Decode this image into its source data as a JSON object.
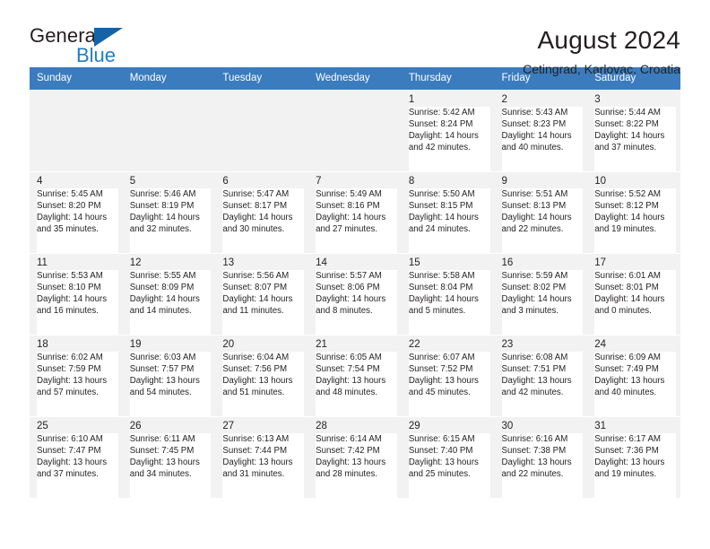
{
  "brand": {
    "name_primary": "General",
    "name_secondary": "Blue",
    "logo_icon": "triangle-logo-icon"
  },
  "header": {
    "title": "August 2024",
    "subtitle": "Cetingrad, Karlovac, Croatia"
  },
  "colors": {
    "header_blue": "#3a7cbe",
    "brand_blue": "#1f7fc4",
    "logo_blue": "#1463a8",
    "cell_background": "#f2f2f2",
    "text": "#231f20"
  },
  "weekdays": [
    "Sunday",
    "Monday",
    "Tuesday",
    "Wednesday",
    "Thursday",
    "Friday",
    "Saturday"
  ],
  "weeks": [
    [
      {
        "day": "",
        "empty": true
      },
      {
        "day": "",
        "empty": true
      },
      {
        "day": "",
        "empty": true
      },
      {
        "day": "",
        "empty": true
      },
      {
        "day": "1",
        "sunrise": "Sunrise: 5:42 AM",
        "sunset": "Sunset: 8:24 PM",
        "daylight1": "Daylight: 14 hours",
        "daylight2": "and 42 minutes."
      },
      {
        "day": "2",
        "sunrise": "Sunrise: 5:43 AM",
        "sunset": "Sunset: 8:23 PM",
        "daylight1": "Daylight: 14 hours",
        "daylight2": "and 40 minutes."
      },
      {
        "day": "3",
        "sunrise": "Sunrise: 5:44 AM",
        "sunset": "Sunset: 8:22 PM",
        "daylight1": "Daylight: 14 hours",
        "daylight2": "and 37 minutes."
      }
    ],
    [
      {
        "day": "4",
        "sunrise": "Sunrise: 5:45 AM",
        "sunset": "Sunset: 8:20 PM",
        "daylight1": "Daylight: 14 hours",
        "daylight2": "and 35 minutes."
      },
      {
        "day": "5",
        "sunrise": "Sunrise: 5:46 AM",
        "sunset": "Sunset: 8:19 PM",
        "daylight1": "Daylight: 14 hours",
        "daylight2": "and 32 minutes."
      },
      {
        "day": "6",
        "sunrise": "Sunrise: 5:47 AM",
        "sunset": "Sunset: 8:17 PM",
        "daylight1": "Daylight: 14 hours",
        "daylight2": "and 30 minutes."
      },
      {
        "day": "7",
        "sunrise": "Sunrise: 5:49 AM",
        "sunset": "Sunset: 8:16 PM",
        "daylight1": "Daylight: 14 hours",
        "daylight2": "and 27 minutes."
      },
      {
        "day": "8",
        "sunrise": "Sunrise: 5:50 AM",
        "sunset": "Sunset: 8:15 PM",
        "daylight1": "Daylight: 14 hours",
        "daylight2": "and 24 minutes."
      },
      {
        "day": "9",
        "sunrise": "Sunrise: 5:51 AM",
        "sunset": "Sunset: 8:13 PM",
        "daylight1": "Daylight: 14 hours",
        "daylight2": "and 22 minutes."
      },
      {
        "day": "10",
        "sunrise": "Sunrise: 5:52 AM",
        "sunset": "Sunset: 8:12 PM",
        "daylight1": "Daylight: 14 hours",
        "daylight2": "and 19 minutes."
      }
    ],
    [
      {
        "day": "11",
        "sunrise": "Sunrise: 5:53 AM",
        "sunset": "Sunset: 8:10 PM",
        "daylight1": "Daylight: 14 hours",
        "daylight2": "and 16 minutes."
      },
      {
        "day": "12",
        "sunrise": "Sunrise: 5:55 AM",
        "sunset": "Sunset: 8:09 PM",
        "daylight1": "Daylight: 14 hours",
        "daylight2": "and 14 minutes."
      },
      {
        "day": "13",
        "sunrise": "Sunrise: 5:56 AM",
        "sunset": "Sunset: 8:07 PM",
        "daylight1": "Daylight: 14 hours",
        "daylight2": "and 11 minutes."
      },
      {
        "day": "14",
        "sunrise": "Sunrise: 5:57 AM",
        "sunset": "Sunset: 8:06 PM",
        "daylight1": "Daylight: 14 hours",
        "daylight2": "and 8 minutes."
      },
      {
        "day": "15",
        "sunrise": "Sunrise: 5:58 AM",
        "sunset": "Sunset: 8:04 PM",
        "daylight1": "Daylight: 14 hours",
        "daylight2": "and 5 minutes."
      },
      {
        "day": "16",
        "sunrise": "Sunrise: 5:59 AM",
        "sunset": "Sunset: 8:02 PM",
        "daylight1": "Daylight: 14 hours",
        "daylight2": "and 3 minutes."
      },
      {
        "day": "17",
        "sunrise": "Sunrise: 6:01 AM",
        "sunset": "Sunset: 8:01 PM",
        "daylight1": "Daylight: 14 hours",
        "daylight2": "and 0 minutes."
      }
    ],
    [
      {
        "day": "18",
        "sunrise": "Sunrise: 6:02 AM",
        "sunset": "Sunset: 7:59 PM",
        "daylight1": "Daylight: 13 hours",
        "daylight2": "and 57 minutes."
      },
      {
        "day": "19",
        "sunrise": "Sunrise: 6:03 AM",
        "sunset": "Sunset: 7:57 PM",
        "daylight1": "Daylight: 13 hours",
        "daylight2": "and 54 minutes."
      },
      {
        "day": "20",
        "sunrise": "Sunrise: 6:04 AM",
        "sunset": "Sunset: 7:56 PM",
        "daylight1": "Daylight: 13 hours",
        "daylight2": "and 51 minutes."
      },
      {
        "day": "21",
        "sunrise": "Sunrise: 6:05 AM",
        "sunset": "Sunset: 7:54 PM",
        "daylight1": "Daylight: 13 hours",
        "daylight2": "and 48 minutes."
      },
      {
        "day": "22",
        "sunrise": "Sunrise: 6:07 AM",
        "sunset": "Sunset: 7:52 PM",
        "daylight1": "Daylight: 13 hours",
        "daylight2": "and 45 minutes."
      },
      {
        "day": "23",
        "sunrise": "Sunrise: 6:08 AM",
        "sunset": "Sunset: 7:51 PM",
        "daylight1": "Daylight: 13 hours",
        "daylight2": "and 42 minutes."
      },
      {
        "day": "24",
        "sunrise": "Sunrise: 6:09 AM",
        "sunset": "Sunset: 7:49 PM",
        "daylight1": "Daylight: 13 hours",
        "daylight2": "and 40 minutes."
      }
    ],
    [
      {
        "day": "25",
        "sunrise": "Sunrise: 6:10 AM",
        "sunset": "Sunset: 7:47 PM",
        "daylight1": "Daylight: 13 hours",
        "daylight2": "and 37 minutes."
      },
      {
        "day": "26",
        "sunrise": "Sunrise: 6:11 AM",
        "sunset": "Sunset: 7:45 PM",
        "daylight1": "Daylight: 13 hours",
        "daylight2": "and 34 minutes."
      },
      {
        "day": "27",
        "sunrise": "Sunrise: 6:13 AM",
        "sunset": "Sunset: 7:44 PM",
        "daylight1": "Daylight: 13 hours",
        "daylight2": "and 31 minutes."
      },
      {
        "day": "28",
        "sunrise": "Sunrise: 6:14 AM",
        "sunset": "Sunset: 7:42 PM",
        "daylight1": "Daylight: 13 hours",
        "daylight2": "and 28 minutes."
      },
      {
        "day": "29",
        "sunrise": "Sunrise: 6:15 AM",
        "sunset": "Sunset: 7:40 PM",
        "daylight1": "Daylight: 13 hours",
        "daylight2": "and 25 minutes."
      },
      {
        "day": "30",
        "sunrise": "Sunrise: 6:16 AM",
        "sunset": "Sunset: 7:38 PM",
        "daylight1": "Daylight: 13 hours",
        "daylight2": "and 22 minutes."
      },
      {
        "day": "31",
        "sunrise": "Sunrise: 6:17 AM",
        "sunset": "Sunset: 7:36 PM",
        "daylight1": "Daylight: 13 hours",
        "daylight2": "and 19 minutes."
      }
    ]
  ]
}
